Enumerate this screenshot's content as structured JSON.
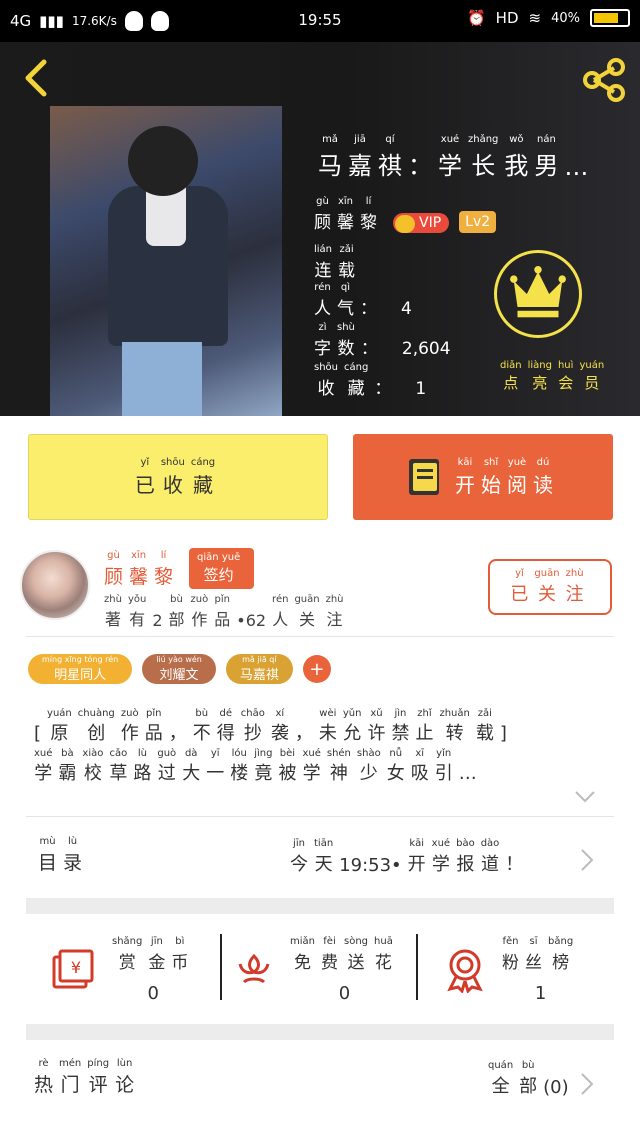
{
  "status": {
    "network": "4G",
    "speed": "17.6K/s",
    "time": "19:55",
    "hd": "HD",
    "battery": "40%"
  },
  "book": {
    "title_chars": [
      {
        "p": "mǎ",
        "c": "马"
      },
      {
        "p": "jiā",
        "c": "嘉"
      },
      {
        "p": "qí",
        "c": "祺"
      },
      {
        "p": "",
        "c": "："
      },
      {
        "p": "xué",
        "c": "学"
      },
      {
        "p": "zhǎng",
        "c": "长"
      },
      {
        "p": "wǒ",
        "c": "我"
      },
      {
        "p": "nán",
        "c": "男"
      },
      {
        "p": "",
        "c": "…"
      }
    ],
    "author_chars": [
      {
        "p": "gù",
        "c": "顾"
      },
      {
        "p": "xīn",
        "c": "馨"
      },
      {
        "p": "lí",
        "c": "黎"
      }
    ],
    "vip_label": "VIP",
    "level": "Lv2",
    "status_chars": [
      {
        "p": "lián",
        "c": "连"
      },
      {
        "p": "zǎi",
        "c": "载"
      }
    ],
    "popularity_chars": [
      {
        "p": "rén",
        "c": "人"
      },
      {
        "p": "qì",
        "c": "气"
      },
      {
        "p": "",
        "c": "："
      }
    ],
    "popularity": "4",
    "words_chars": [
      {
        "p": "zì",
        "c": "字"
      },
      {
        "p": "shù",
        "c": "数"
      },
      {
        "p": "",
        "c": "："
      }
    ],
    "words": "2,604",
    "favs_chars": [
      {
        "p": "shōu",
        "c": "收"
      },
      {
        "p": "cáng",
        "c": "藏"
      },
      {
        "p": "",
        "c": "："
      }
    ],
    "favs": "1",
    "vip_caption_chars": [
      {
        "p": "diǎn",
        "c": "点"
      },
      {
        "p": "liàng",
        "c": "亮"
      },
      {
        "p": "huì",
        "c": "会"
      },
      {
        "p": "yuán",
        "c": "员"
      }
    ]
  },
  "actions": {
    "fav_chars": [
      {
        "p": "yǐ",
        "c": "已"
      },
      {
        "p": "shōu",
        "c": "收"
      },
      {
        "p": "cáng",
        "c": "藏"
      }
    ],
    "read_chars": [
      {
        "p": "kāi",
        "c": "开"
      },
      {
        "p": "shǐ",
        "c": "始"
      },
      {
        "p": "yuè",
        "c": "阅"
      },
      {
        "p": "dú",
        "c": "读"
      }
    ]
  },
  "author": {
    "name_chars": [
      {
        "p": "gù",
        "c": "顾"
      },
      {
        "p": "xīn",
        "c": "馨"
      },
      {
        "p": "lí",
        "c": "黎"
      }
    ],
    "sign_pinyin": "qiān yuē",
    "sign": "签约",
    "info_chars": [
      {
        "p": "zhù",
        "c": "著"
      },
      {
        "p": "yǒu",
        "c": "有"
      },
      {
        "p": "",
        "c": "2"
      },
      {
        "p": "bù",
        "c": "部"
      },
      {
        "p": "zuò",
        "c": "作"
      },
      {
        "p": "pǐn",
        "c": "品"
      },
      {
        "p": "",
        "c": "•62"
      },
      {
        "p": "rén",
        "c": "人"
      },
      {
        "p": "guān",
        "c": "关"
      },
      {
        "p": "zhù",
        "c": "注"
      }
    ],
    "follow_chars": [
      {
        "p": "yǐ",
        "c": "已"
      },
      {
        "p": "guān",
        "c": "关"
      },
      {
        "p": "zhù",
        "c": "注"
      }
    ]
  },
  "tags": [
    {
      "pinyin": "míng xīng tóng rén",
      "text": "明星同人",
      "color": "#f2b132"
    },
    {
      "pinyin": "liú yào wén",
      "text": "刘耀文",
      "color": "#b86d4b"
    },
    {
      "pinyin": "mǎ jiā qí",
      "text": "马嘉祺",
      "color": "#d9a233"
    }
  ],
  "tag_add": "+",
  "description": {
    "line1": [
      {
        "p": "",
        "c": "["
      },
      {
        "p": "yuán",
        "c": "原"
      },
      {
        "p": "chuàng",
        "c": "创"
      },
      {
        "p": "zuò",
        "c": "作"
      },
      {
        "p": "pǐn",
        "c": "品"
      },
      {
        "p": "",
        "c": "，"
      },
      {
        "p": "bù",
        "c": "不"
      },
      {
        "p": "dé",
        "c": "得"
      },
      {
        "p": "chāo",
        "c": "抄"
      },
      {
        "p": "xí",
        "c": "袭"
      },
      {
        "p": "",
        "c": "，"
      },
      {
        "p": "wèi",
        "c": "未"
      },
      {
        "p": "yǔn",
        "c": "允"
      },
      {
        "p": "xǔ",
        "c": "许"
      },
      {
        "p": "jìn",
        "c": "禁"
      },
      {
        "p": "zhǐ",
        "c": "止"
      },
      {
        "p": "zhuǎn",
        "c": "转"
      },
      {
        "p": "zǎi",
        "c": "载"
      },
      {
        "p": "",
        "c": "]"
      }
    ],
    "line2": [
      {
        "p": "xué",
        "c": "学"
      },
      {
        "p": "bà",
        "c": "霸"
      },
      {
        "p": "xiào",
        "c": "校"
      },
      {
        "p": "cǎo",
        "c": "草"
      },
      {
        "p": "lù",
        "c": "路"
      },
      {
        "p": "guò",
        "c": "过"
      },
      {
        "p": "dà",
        "c": "大"
      },
      {
        "p": "yī",
        "c": "一"
      },
      {
        "p": "lóu",
        "c": "楼"
      },
      {
        "p": "jìng",
        "c": "竟"
      },
      {
        "p": "bèi",
        "c": "被"
      },
      {
        "p": "xué",
        "c": "学"
      },
      {
        "p": "shén",
        "c": "神"
      },
      {
        "p": "shào",
        "c": "少"
      },
      {
        "p": "nǚ",
        "c": "女"
      },
      {
        "p": "xī",
        "c": "吸"
      },
      {
        "p": "yǐn",
        "c": "引"
      },
      {
        "p": "",
        "c": "…"
      }
    ]
  },
  "catalog": {
    "label_chars": [
      {
        "p": "mù",
        "c": "目"
      },
      {
        "p": "lù",
        "c": "录"
      }
    ],
    "latest_chars": [
      {
        "p": "jīn",
        "c": "今"
      },
      {
        "p": "tiān",
        "c": "天"
      },
      {
        "p": "",
        "c": "19:53•"
      },
      {
        "p": "kāi",
        "c": "开"
      },
      {
        "p": "xué",
        "c": "学"
      },
      {
        "p": "bào",
        "c": "报"
      },
      {
        "p": "dào",
        "c": "道"
      },
      {
        "p": "",
        "c": "！"
      }
    ]
  },
  "stats": [
    {
      "chars": [
        {
          "p": "shǎng",
          "c": "赏"
        },
        {
          "p": "jīn",
          "c": "金"
        },
        {
          "p": "bì",
          "c": "币"
        }
      ],
      "value": "0",
      "icon": "red-envelope-icon"
    },
    {
      "chars": [
        {
          "p": "miǎn",
          "c": "免"
        },
        {
          "p": "fèi",
          "c": "费"
        },
        {
          "p": "sòng",
          "c": "送"
        },
        {
          "p": "huā",
          "c": "花"
        }
      ],
      "value": "0",
      "icon": "flower-icon"
    },
    {
      "chars": [
        {
          "p": "fěn",
          "c": "粉"
        },
        {
          "p": "sī",
          "c": "丝"
        },
        {
          "p": "bǎng",
          "c": "榜"
        }
      ],
      "value": "1",
      "icon": "medal-icon"
    }
  ],
  "comments": {
    "hot_chars": [
      {
        "p": "rè",
        "c": "热"
      },
      {
        "p": "mén",
        "c": "门"
      },
      {
        "p": "píng",
        "c": "评"
      },
      {
        "p": "lùn",
        "c": "论"
      }
    ],
    "all_chars": [
      {
        "p": "quán",
        "c": "全"
      },
      {
        "p": "bù",
        "c": "部"
      }
    ],
    "all_count": "(0)"
  },
  "colors": {
    "accent": "#e9643b",
    "yellow_button": "#fbee6c",
    "crown": "#f5e24a"
  }
}
